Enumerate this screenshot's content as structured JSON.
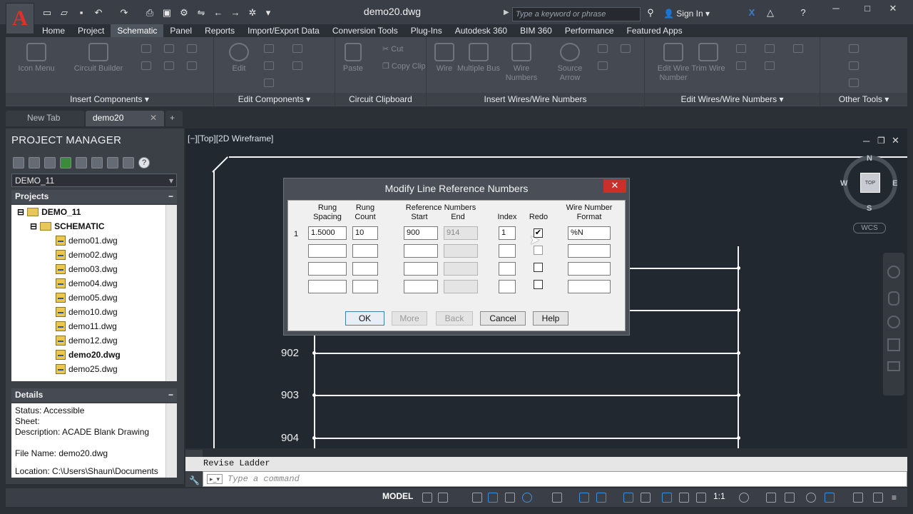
{
  "app": {
    "title": "demo20.dwg",
    "search_placeholder": "Type a keyword or phrase",
    "sign_in": "Sign In"
  },
  "ribbon": {
    "tabs": [
      "Home",
      "Project",
      "Schematic",
      "Panel",
      "Reports",
      "Import/Export Data",
      "Conversion Tools",
      "Plug-Ins",
      "Autodesk 360",
      "BIM 360",
      "Performance",
      "Featured Apps"
    ],
    "active_tab": "Schematic",
    "panels": [
      {
        "title": "Insert Components",
        "buttons": [
          "Icon Menu",
          "Circuit Builder"
        ]
      },
      {
        "title": "Edit Components",
        "buttons": [
          "Edit"
        ]
      },
      {
        "title": "Circuit Clipboard",
        "buttons": [
          "Paste",
          "Cut",
          "Copy Clip"
        ]
      },
      {
        "title": "Insert Wires/Wire Numbers",
        "buttons": [
          "Wire",
          "Multiple Bus",
          "Wire Numbers",
          "Source Arrow"
        ]
      },
      {
        "title": "Edit Wires/Wire Numbers",
        "buttons": [
          "Edit Wire Number",
          "Trim Wire"
        ]
      },
      {
        "title": "Other Tools",
        "buttons": []
      }
    ]
  },
  "doc_tabs": [
    "New Tab",
    "demo20"
  ],
  "project_manager": {
    "title": "PROJECT MANAGER",
    "selected_project": "DEMO_11",
    "projects_label": "Projects",
    "tree": {
      "root": "DEMO_11",
      "folder": "SCHEMATIC",
      "files": [
        "demo01.dwg",
        "demo02.dwg",
        "demo03.dwg",
        "demo04.dwg",
        "demo05.dwg",
        "demo10.dwg",
        "demo11.dwg",
        "demo12.dwg",
        "demo20.dwg",
        "demo25.dwg"
      ],
      "active_file": "demo20.dwg"
    },
    "details_label": "Details",
    "details": [
      "Status: Accessible",
      "Sheet:",
      "Description: ACADE Blank Drawing",
      "",
      "File Name: demo20.dwg",
      "Location: C:\\Users\\Shaun\\Documents"
    ]
  },
  "viewport": {
    "label": "[−][Top][2D Wireframe]",
    "rung_numbers": [
      "902",
      "903",
      "904"
    ],
    "viewcube": {
      "top": "TOP",
      "n": "N",
      "s": "S",
      "e": "E",
      "w": "W",
      "wcs": "WCS"
    }
  },
  "dialog": {
    "title": "Modify Line Reference Numbers",
    "headers": {
      "rung_spacing": "Rung\nSpacing",
      "rung_count": "Rung\nCount",
      "ref_numbers": "Reference Numbers",
      "start": "Start",
      "end": "End",
      "index": "Index",
      "redo": "Redo",
      "wire_format": "Wire Number\nFormat"
    },
    "row_label": "1",
    "row1": {
      "spacing": "1.5000",
      "count": "10",
      "start": "900",
      "end": "914",
      "index": "1",
      "redo": true,
      "format": "%N"
    },
    "buttons": {
      "ok": "OK",
      "more": "More",
      "back": "Back",
      "cancel": "Cancel",
      "help": "Help"
    }
  },
  "command": {
    "history": "Revise Ladder",
    "placeholder": "Type a command"
  },
  "status_bar": {
    "model": "MODEL",
    "scale": "1:1"
  }
}
